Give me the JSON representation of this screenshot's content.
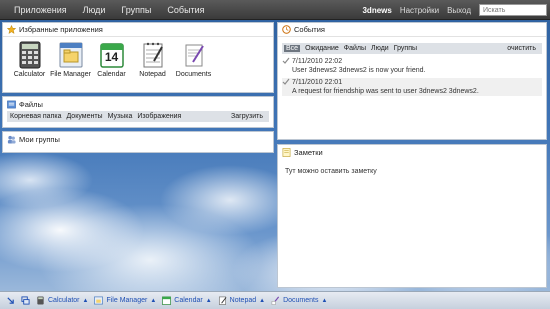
{
  "topbar": {
    "nav": [
      "Приложения",
      "Люди",
      "Группы",
      "События"
    ],
    "user": "3dnews",
    "settings": "Настройки",
    "logout": "Выход",
    "search_placeholder": "Искать"
  },
  "favorites": {
    "title": "Избранные приложения",
    "apps": [
      {
        "label": "Calculator",
        "icon": "calculator-icon"
      },
      {
        "label": "File Manager",
        "icon": "file-manager-icon"
      },
      {
        "label": "Calendar",
        "icon": "calendar-icon",
        "day": "14"
      },
      {
        "label": "Notepad",
        "icon": "notepad-icon"
      },
      {
        "label": "Documents",
        "icon": "documents-icon"
      }
    ]
  },
  "files": {
    "title": "Файлы",
    "tabs": [
      "Корневая папка",
      "Документы",
      "Музыка",
      "Изображения"
    ],
    "upload": "Загрузить"
  },
  "groups": {
    "title": "Мои группы"
  },
  "events": {
    "title": "События",
    "tabs": [
      "Все",
      "Ожидание",
      "Файлы",
      "Люди",
      "Группы"
    ],
    "clear": "очистить",
    "items": [
      {
        "time": "7/11/2010 22:02",
        "text": "User 3dnews2 3dnews2 is now your friend."
      },
      {
        "time": "7/11/2010 22:01",
        "text": "A request for friendship was sent to user 3dnews2 3dnews2."
      }
    ]
  },
  "notes": {
    "title": "Заметки",
    "text": "Тут можно оставить заметку"
  },
  "taskbar": {
    "items": [
      "Calculator",
      "File Manager",
      "Calendar",
      "Notepad",
      "Documents"
    ]
  },
  "colors": {
    "topbar": "#444444",
    "taskbar_text": "#1e4fb4",
    "tab_selected": "#6e7680"
  }
}
